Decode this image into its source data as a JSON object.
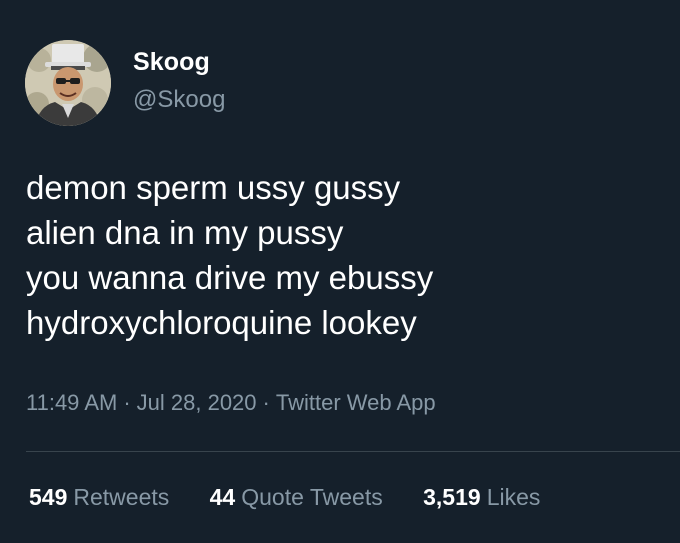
{
  "user": {
    "display_name": "Skoog",
    "handle": "@Skoog",
    "avatar_icon": "profile-photo"
  },
  "tweet": {
    "lines": [
      "demon sperm ussy gussy",
      "alien dna in my pussy",
      "you wanna drive my ebussy",
      "hydroxychloroquine lookey"
    ],
    "time": "11:49 AM",
    "separator": "·",
    "date": "Jul 28, 2020",
    "source": "Twitter Web App"
  },
  "stats": {
    "retweets": {
      "count": "549",
      "label": "Retweets"
    },
    "quote_tweets": {
      "count": "44",
      "label": "Quote Tweets"
    },
    "likes": {
      "count": "3,519",
      "label": "Likes"
    }
  },
  "colors": {
    "background": "#15202b",
    "primary_text": "#ffffff",
    "secondary_text": "#8899a6",
    "divider": "#38444d"
  }
}
